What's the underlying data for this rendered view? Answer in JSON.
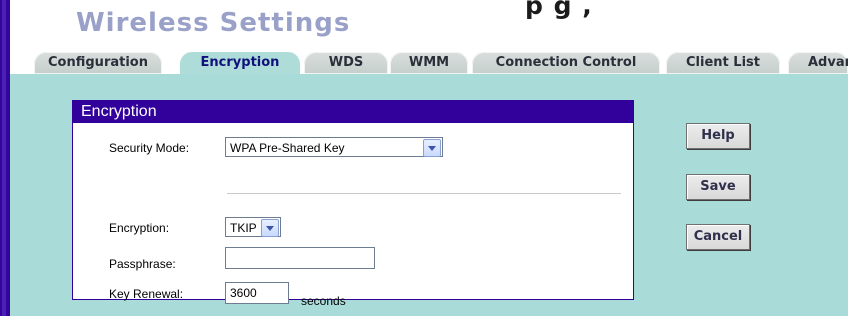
{
  "header": {
    "top_fragment": "p   g   ,",
    "title": "Wireless Settings"
  },
  "tabs": [
    {
      "label": "Configuration"
    },
    {
      "label": "Encryption",
      "active": true
    },
    {
      "label": "WDS"
    },
    {
      "label": "WMM"
    },
    {
      "label": "Connection Control"
    },
    {
      "label": "Client List"
    },
    {
      "label": "Advar"
    }
  ],
  "panel": {
    "title": "Encryption",
    "security_mode": {
      "label": "Security Mode:",
      "value": "WPA Pre-Shared Key"
    },
    "encryption": {
      "label": "Encryption:",
      "value": "TKIP"
    },
    "passphrase": {
      "label": "Passphrase:",
      "value": ""
    },
    "key_renewal": {
      "label": "Key Renewal:",
      "value": "3600",
      "unit": "seconds"
    }
  },
  "buttons": {
    "help": "Help",
    "save": "Save",
    "cancel": "Cancel"
  },
  "colors": {
    "accent": "#32009b",
    "content_bg": "#a9dcd8",
    "title_color": "#9aa1c8"
  }
}
